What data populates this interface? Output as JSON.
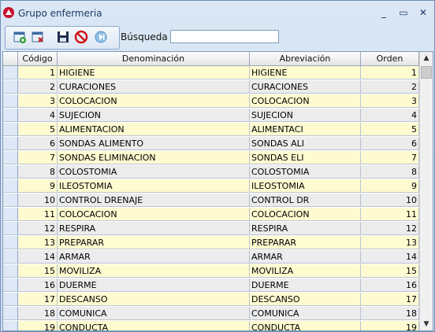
{
  "window": {
    "title": "Grupo enfermeria"
  },
  "window_controls": {
    "minimize": "_",
    "maximize": "▭",
    "close": "✕"
  },
  "toolbar": {
    "search_label": "Búsqueda",
    "search_value": ""
  },
  "grid": {
    "columns": [
      "Código",
      "Denominación",
      "Abreviación",
      "Orden"
    ],
    "rows": [
      {
        "codigo": "1",
        "denominacion": "HIGIENE",
        "abreviacion": "HIGIENE",
        "orden": "1"
      },
      {
        "codigo": "2",
        "denominacion": "CURACIONES",
        "abreviacion": "CURACIONES",
        "orden": "2"
      },
      {
        "codigo": "3",
        "denominacion": "COLOCACION",
        "abreviacion": "COLOCACION",
        "orden": "3"
      },
      {
        "codigo": "4",
        "denominacion": "SUJECION",
        "abreviacion": "SUJECION",
        "orden": "4"
      },
      {
        "codigo": "5",
        "denominacion": "ALIMENTACION",
        "abreviacion": "ALIMENTACI",
        "orden": "5"
      },
      {
        "codigo": "6",
        "denominacion": "SONDAS ALIMENTO",
        "abreviacion": "SONDAS ALI",
        "orden": "6"
      },
      {
        "codigo": "7",
        "denominacion": "SONDAS ELIMINACION",
        "abreviacion": "SONDAS ELI",
        "orden": "7"
      },
      {
        "codigo": "8",
        "denominacion": "COLOSTOMIA",
        "abreviacion": "COLOSTOMIA",
        "orden": "8"
      },
      {
        "codigo": "9",
        "denominacion": "ILEOSTOMIA",
        "abreviacion": "ILEOSTOMIA",
        "orden": "9"
      },
      {
        "codigo": "10",
        "denominacion": "CONTROL DRENAJE",
        "abreviacion": "CONTROL DR",
        "orden": "10"
      },
      {
        "codigo": "11",
        "denominacion": "COLOCACION",
        "abreviacion": "COLOCACION",
        "orden": "11"
      },
      {
        "codigo": "12",
        "denominacion": "RESPIRA",
        "abreviacion": "RESPIRA",
        "orden": "12"
      },
      {
        "codigo": "13",
        "denominacion": "PREPARAR",
        "abreviacion": "PREPARAR",
        "orden": "13"
      },
      {
        "codigo": "14",
        "denominacion": "ARMAR",
        "abreviacion": "ARMAR",
        "orden": "14"
      },
      {
        "codigo": "15",
        "denominacion": "MOVILIZA",
        "abreviacion": "MOVILIZA",
        "orden": "15"
      },
      {
        "codigo": "16",
        "denominacion": "DUERME",
        "abreviacion": "DUERME",
        "orden": "16"
      },
      {
        "codigo": "17",
        "denominacion": "DESCANSO",
        "abreviacion": "DESCANSO",
        "orden": "17"
      },
      {
        "codigo": "18",
        "denominacion": "COMUNICA",
        "abreviacion": "COMUNICA",
        "orden": "18"
      },
      {
        "codigo": "19",
        "denominacion": "CONDUCTA",
        "abreviacion": "CONDUCTA",
        "orden": "19"
      }
    ]
  }
}
